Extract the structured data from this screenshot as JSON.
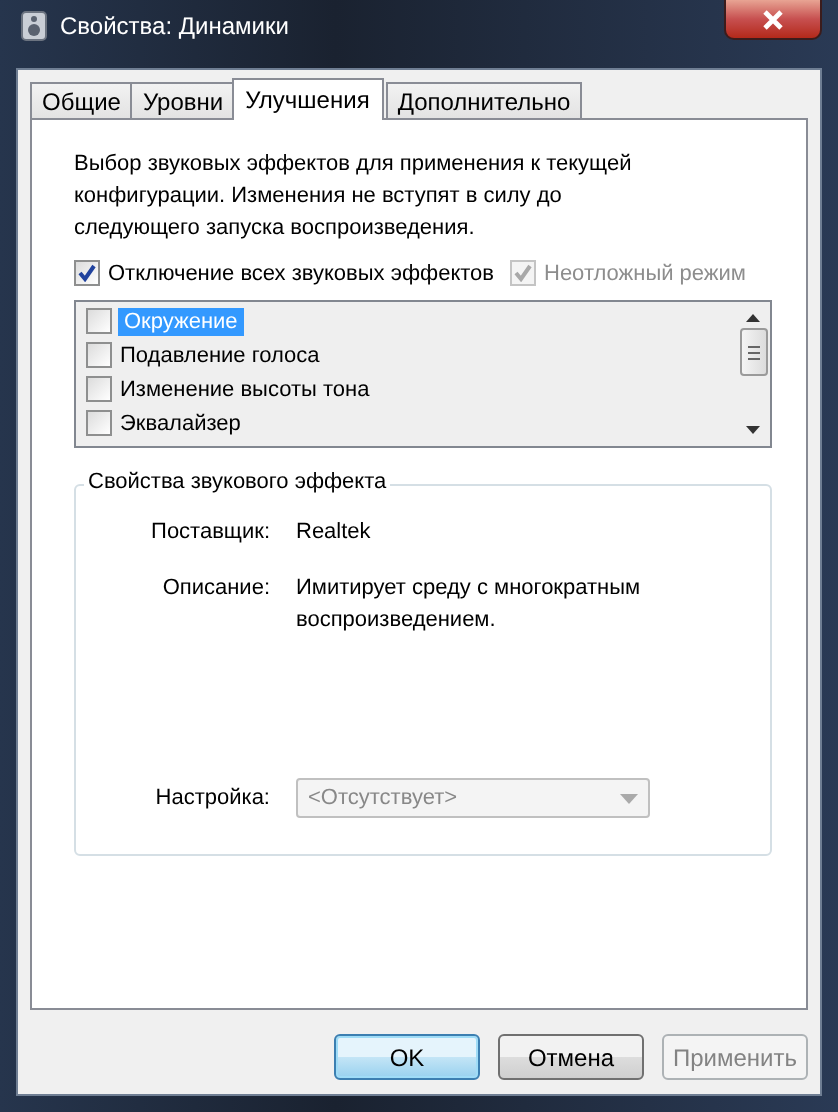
{
  "window": {
    "title": "Свойства: Динамики"
  },
  "tabs": [
    {
      "label": "Общие",
      "selected": false
    },
    {
      "label": "Уровни",
      "selected": false
    },
    {
      "label": "Улучшения",
      "selected": true
    },
    {
      "label": "Дополнительно",
      "selected": false
    }
  ],
  "description": "Выбор звуковых эффектов для применения к текущей конфигурации. Изменения не вступят в силу до следующего запуска воспроизведения.",
  "options": [
    {
      "label": "Отключение всех звуковых эффектов",
      "checked": true,
      "disabled": false
    },
    {
      "label": "Неотложный режим",
      "checked": true,
      "disabled": true
    }
  ],
  "effects": [
    {
      "label": "Окружение",
      "checked": false,
      "selected": true
    },
    {
      "label": "Подавление голоса",
      "checked": false,
      "selected": false
    },
    {
      "label": "Изменение высоты тона",
      "checked": false,
      "selected": false
    },
    {
      "label": "Эквалайзер",
      "checked": false,
      "selected": false
    }
  ],
  "properties": {
    "title": "Свойства звукового эффекта",
    "fields": [
      {
        "label": "Поставщик:",
        "value": "Realtek"
      },
      {
        "label": "Описание:",
        "value": "Имитирует среду с многократным воспроизведением."
      }
    ],
    "setting": {
      "label": "Настройка:",
      "value": "<Отсутствует>",
      "disabled": true
    }
  },
  "buttons": [
    {
      "label": "OK",
      "default": true,
      "disabled": false
    },
    {
      "label": "Отмена",
      "default": false,
      "disabled": false
    },
    {
      "label": "Применить",
      "default": false,
      "disabled": true
    }
  ]
}
